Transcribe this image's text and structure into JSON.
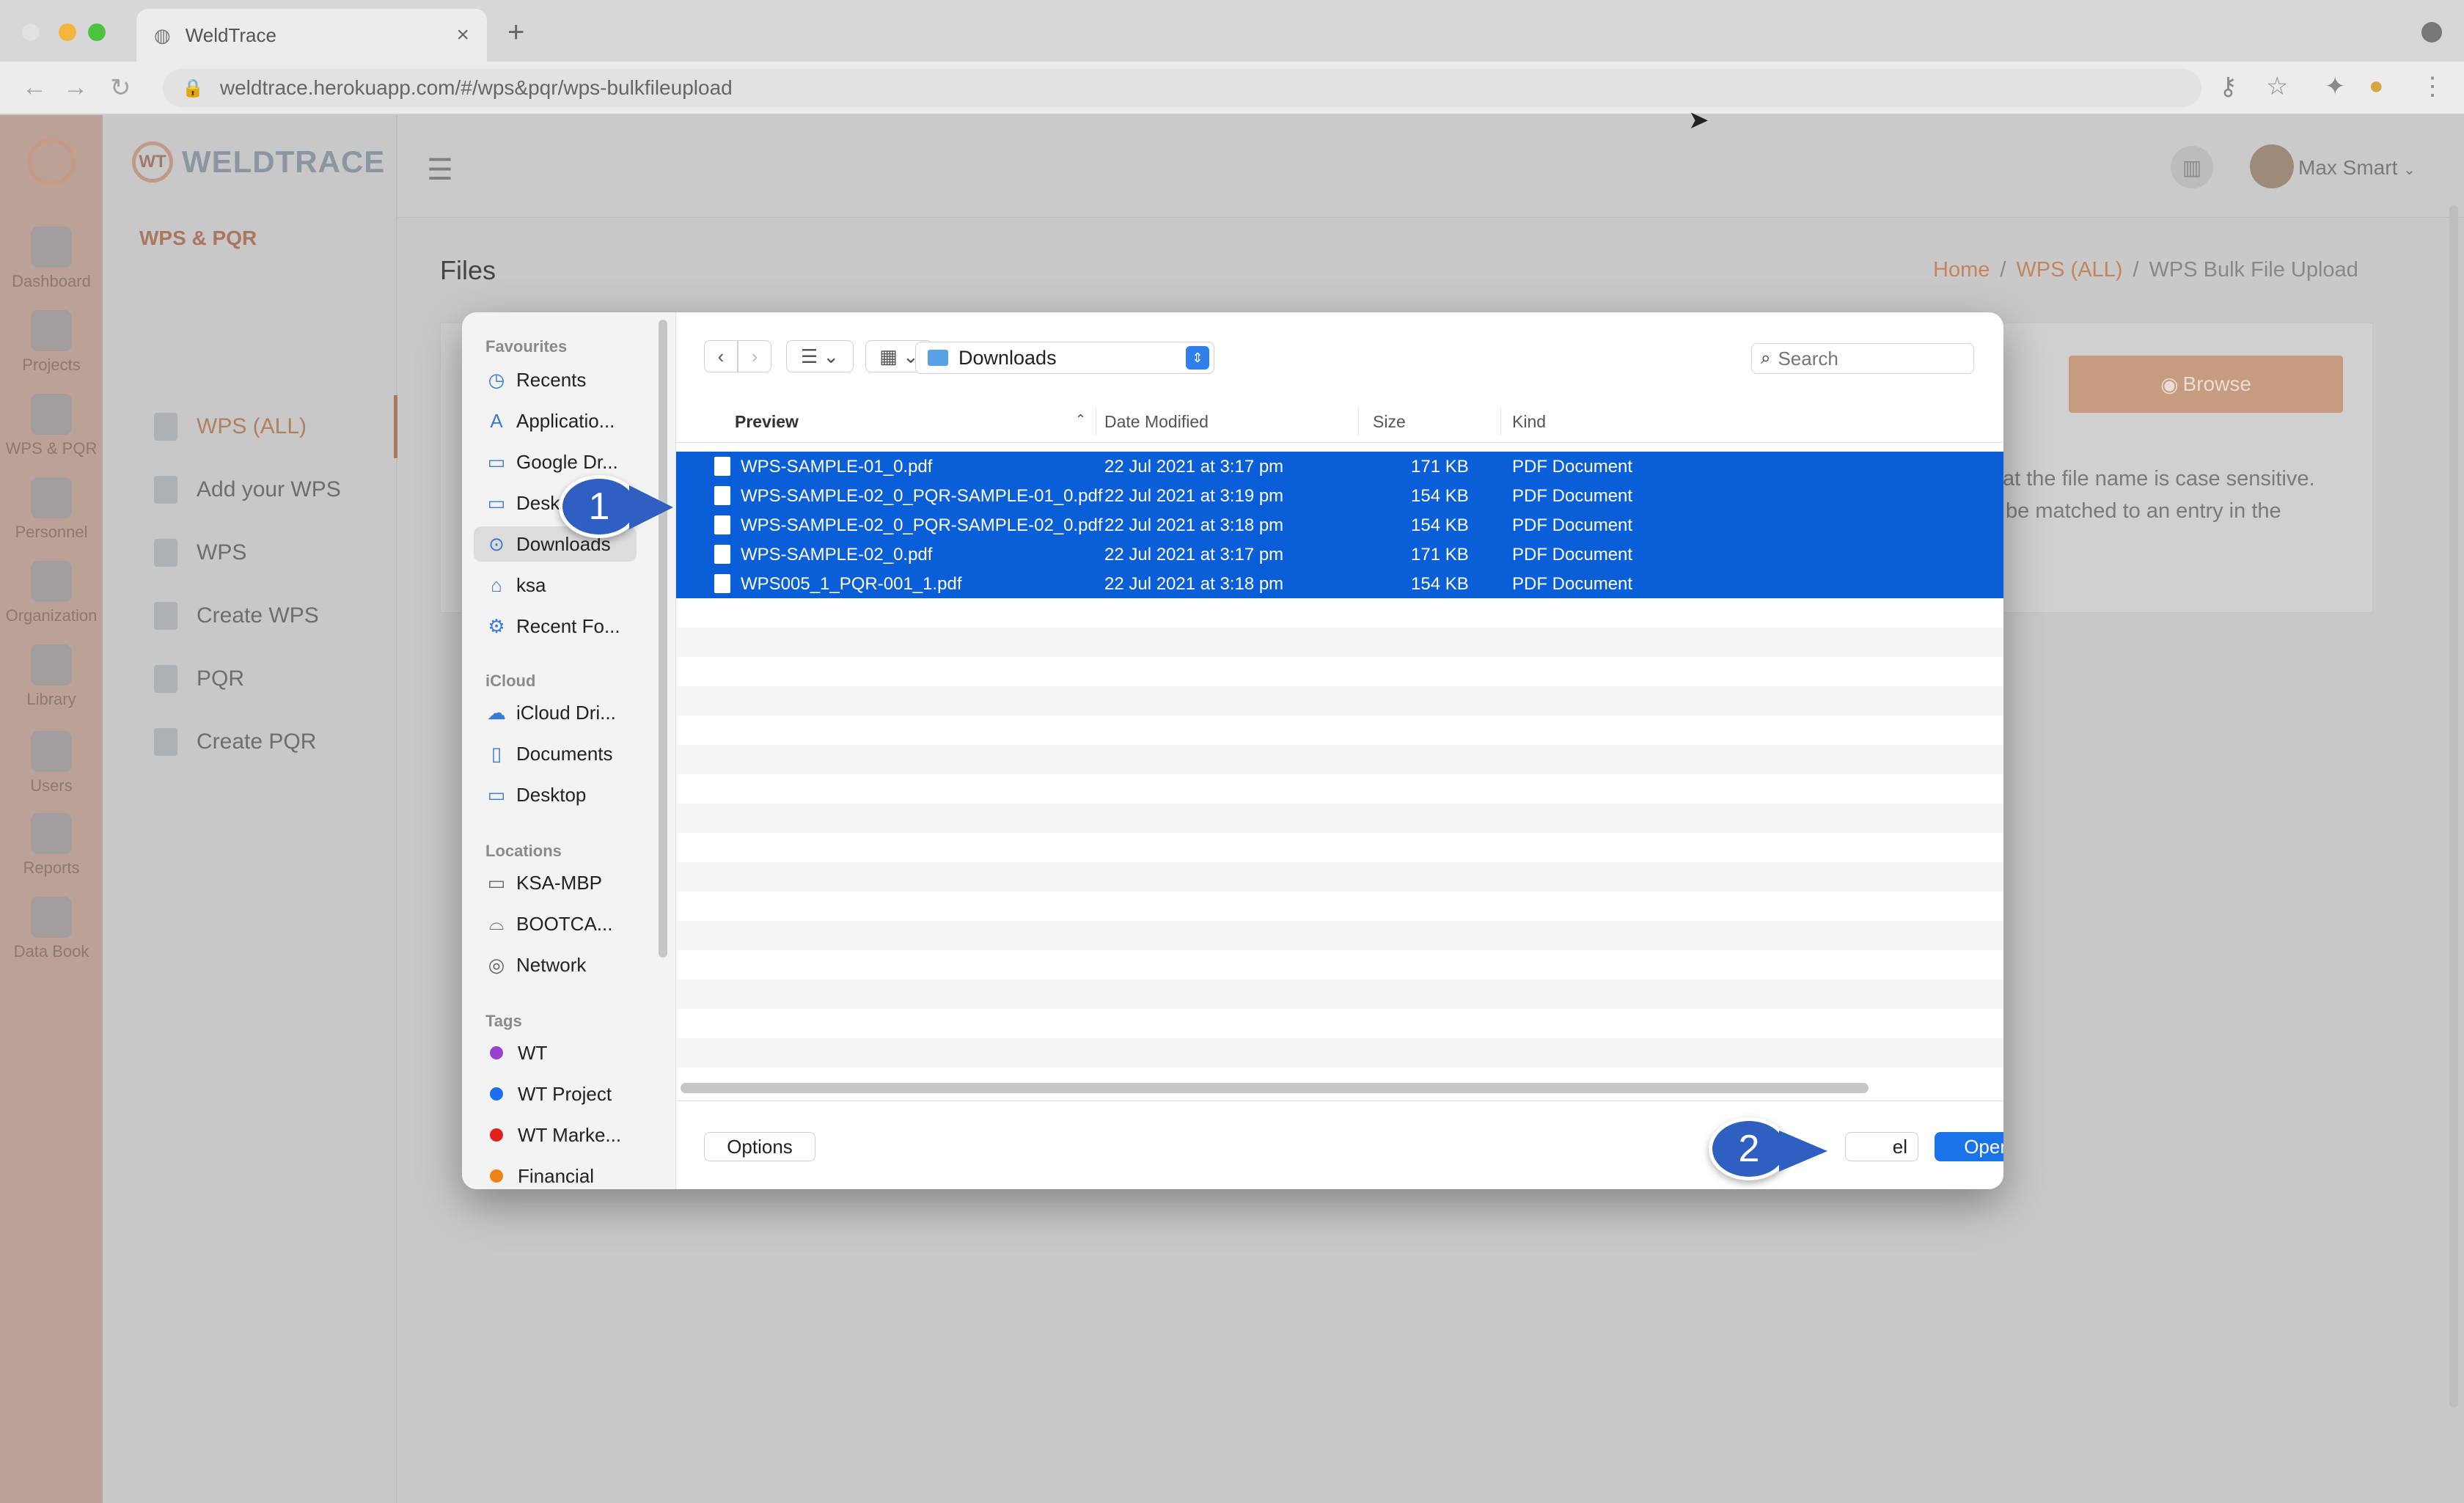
{
  "browser": {
    "tab_title": "WeldTrace",
    "url": "weldtrace.herokuapp.com/#/wps&pqr/wps-bulkfileupload",
    "new_tab": "+",
    "close_tab": "×"
  },
  "rail": {
    "items": [
      {
        "label": "Dashboard",
        "icon": "dashboard-icon"
      },
      {
        "label": "Projects",
        "icon": "projects-icon"
      },
      {
        "label": "WPS & PQR",
        "icon": "wps-pqr-icon"
      },
      {
        "label": "Personnel",
        "icon": "personnel-icon"
      },
      {
        "label": "Organization",
        "icon": "organization-icon"
      },
      {
        "label": "Library",
        "icon": "library-icon"
      },
      {
        "label": "Users",
        "icon": "users-icon"
      },
      {
        "label": "Reports",
        "icon": "reports-icon"
      },
      {
        "label": "Data Book",
        "icon": "data-book-icon"
      }
    ]
  },
  "sidenav": {
    "logo_mark": "WT",
    "logo_text": "WELDTRACE",
    "section_title": "WPS & PQR",
    "items": [
      {
        "label": "WPS (ALL)",
        "active": true
      },
      {
        "label": "Add your WPS",
        "active": false
      },
      {
        "label": "WPS",
        "active": false
      },
      {
        "label": "Create WPS",
        "active": false
      },
      {
        "label": "PQR",
        "active": false
      },
      {
        "label": "Create PQR",
        "active": false
      }
    ]
  },
  "header": {
    "user_name": "Max Smart"
  },
  "page": {
    "title": "Files",
    "breadcrumb": [
      "Home",
      "WPS (ALL)",
      "WPS Bulk File Upload"
    ],
    "breadcrumb_sep": "/",
    "browse_label": "Browse",
    "text_line1": "at the file name is case sensitive.",
    "text_line2": "be matched to an entry in the"
  },
  "dialog": {
    "sidebar": {
      "favourites_title": "Favourites",
      "favourites": [
        "Recents",
        "Applicatio...",
        "Google Dr...",
        "Desk",
        "Downloads",
        "ksa",
        "Recent Fo..."
      ],
      "selected": "Downloads",
      "icloud_title": "iCloud",
      "icloud": [
        "iCloud Dri...",
        "Documents",
        "Desktop"
      ],
      "locations_title": "Locations",
      "locations": [
        "KSA-MBP",
        "BOOTCA...",
        "Network"
      ],
      "tags_title": "Tags",
      "tags": [
        {
          "label": "WT",
          "color": "#9b3fcf"
        },
        {
          "label": "WT Project",
          "color": "#1d6ff2"
        },
        {
          "label": "WT Marke...",
          "color": "#e0201c"
        },
        {
          "label": "Financial",
          "color": "#f0821a"
        }
      ]
    },
    "folder": "Downloads",
    "search_placeholder": "Search",
    "columns": {
      "name": "Preview",
      "date": "Date Modified",
      "size": "Size",
      "kind": "Kind"
    },
    "files": [
      {
        "name": "WPS-SAMPLE-01_0.pdf",
        "date": "22 Jul 2021 at 3:17 pm",
        "size": "171 KB",
        "kind": "PDF Document"
      },
      {
        "name": "WPS-SAMPLE-02_0_PQR-SAMPLE-01_0.pdf",
        "date": "22 Jul 2021 at 3:19 pm",
        "size": "154 KB",
        "kind": "PDF Document"
      },
      {
        "name": "WPS-SAMPLE-02_0_PQR-SAMPLE-02_0.pdf",
        "date": "22 Jul 2021 at 3:18 pm",
        "size": "154 KB",
        "kind": "PDF Document"
      },
      {
        "name": "WPS-SAMPLE-02_0.pdf",
        "date": "22 Jul 2021 at 3:17 pm",
        "size": "171 KB",
        "kind": "PDF Document"
      },
      {
        "name": "WPS005_1_PQR-001_1.pdf",
        "date": "22 Jul 2021 at 3:18 pm",
        "size": "154 KB",
        "kind": "PDF Document"
      }
    ],
    "options_label": "Options",
    "cancel_label": "el",
    "open_label": "Open"
  },
  "callouts": {
    "one": "1",
    "two": "2"
  },
  "colors": {
    "selection": "#0a5fd8",
    "accent": "#a9785f",
    "open_button": "#1a73e8"
  }
}
